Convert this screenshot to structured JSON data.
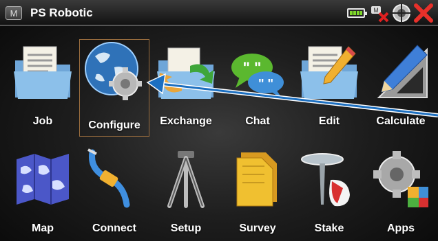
{
  "titlebar": {
    "menu_glyph": "M",
    "title": "PS Robotic",
    "status_icons": [
      "battery-icon",
      "no-connection-icon",
      "target-icon",
      "close-icon"
    ]
  },
  "tiles": [
    {
      "label": "Job",
      "icon": "folder-document-icon"
    },
    {
      "label": "Configure",
      "icon": "globe-gear-icon",
      "selected": true
    },
    {
      "label": "Exchange",
      "icon": "folder-arrow-icon"
    },
    {
      "label": "Chat",
      "icon": "speech-bubbles-icon"
    },
    {
      "label": "Edit",
      "icon": "document-pencil-icon"
    },
    {
      "label": "Calculate",
      "icon": "pencil-ruler-icon"
    },
    {
      "label": "Map",
      "icon": "folded-map-icon"
    },
    {
      "label": "Connect",
      "icon": "cable-plug-icon"
    },
    {
      "label": "Setup",
      "icon": "tripod-icon"
    },
    {
      "label": "Survey",
      "icon": "yellow-folders-icon"
    },
    {
      "label": "Stake",
      "icon": "stake-pin-icon"
    },
    {
      "label": "Apps",
      "icon": "gear-blocks-icon"
    }
  ]
}
